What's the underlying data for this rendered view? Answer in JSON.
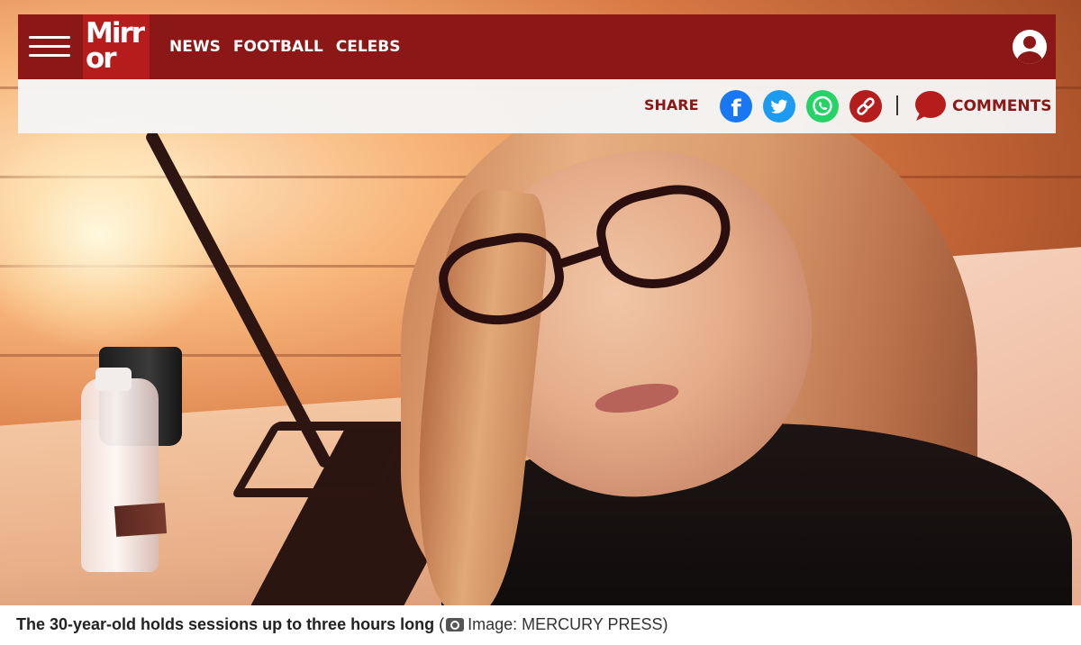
{
  "header": {
    "logo_line1": "Mirr",
    "logo_line2": "or",
    "nav": [
      {
        "label": "NEWS"
      },
      {
        "label": "FOOTBALL"
      },
      {
        "label": "CELEBS"
      }
    ],
    "menu_icon": "hamburger-icon",
    "account_icon": "account-icon"
  },
  "share_bar": {
    "share_label": "SHARE",
    "networks": [
      {
        "name": "facebook",
        "icon": "facebook-icon",
        "glyph": "f",
        "color": "#1877f2"
      },
      {
        "name": "twitter",
        "icon": "twitter-icon",
        "color": "#1d9bf0"
      },
      {
        "name": "whatsapp",
        "icon": "whatsapp-icon",
        "color": "#25d366"
      },
      {
        "name": "copy-link",
        "icon": "link-icon",
        "color": "#b51d1d"
      }
    ],
    "comments_label": "COMMENTS",
    "comments_icon": "comment-bubble-icon"
  },
  "caption": {
    "text": "The 30-year-old holds sessions up to three hours long",
    "open_paren": " (",
    "credit": "Image: MERCURY PRESS)",
    "credit_icon": "camera-icon"
  },
  "colors": {
    "brand": "#8b1717",
    "logo_bg": "#b51d1d"
  }
}
